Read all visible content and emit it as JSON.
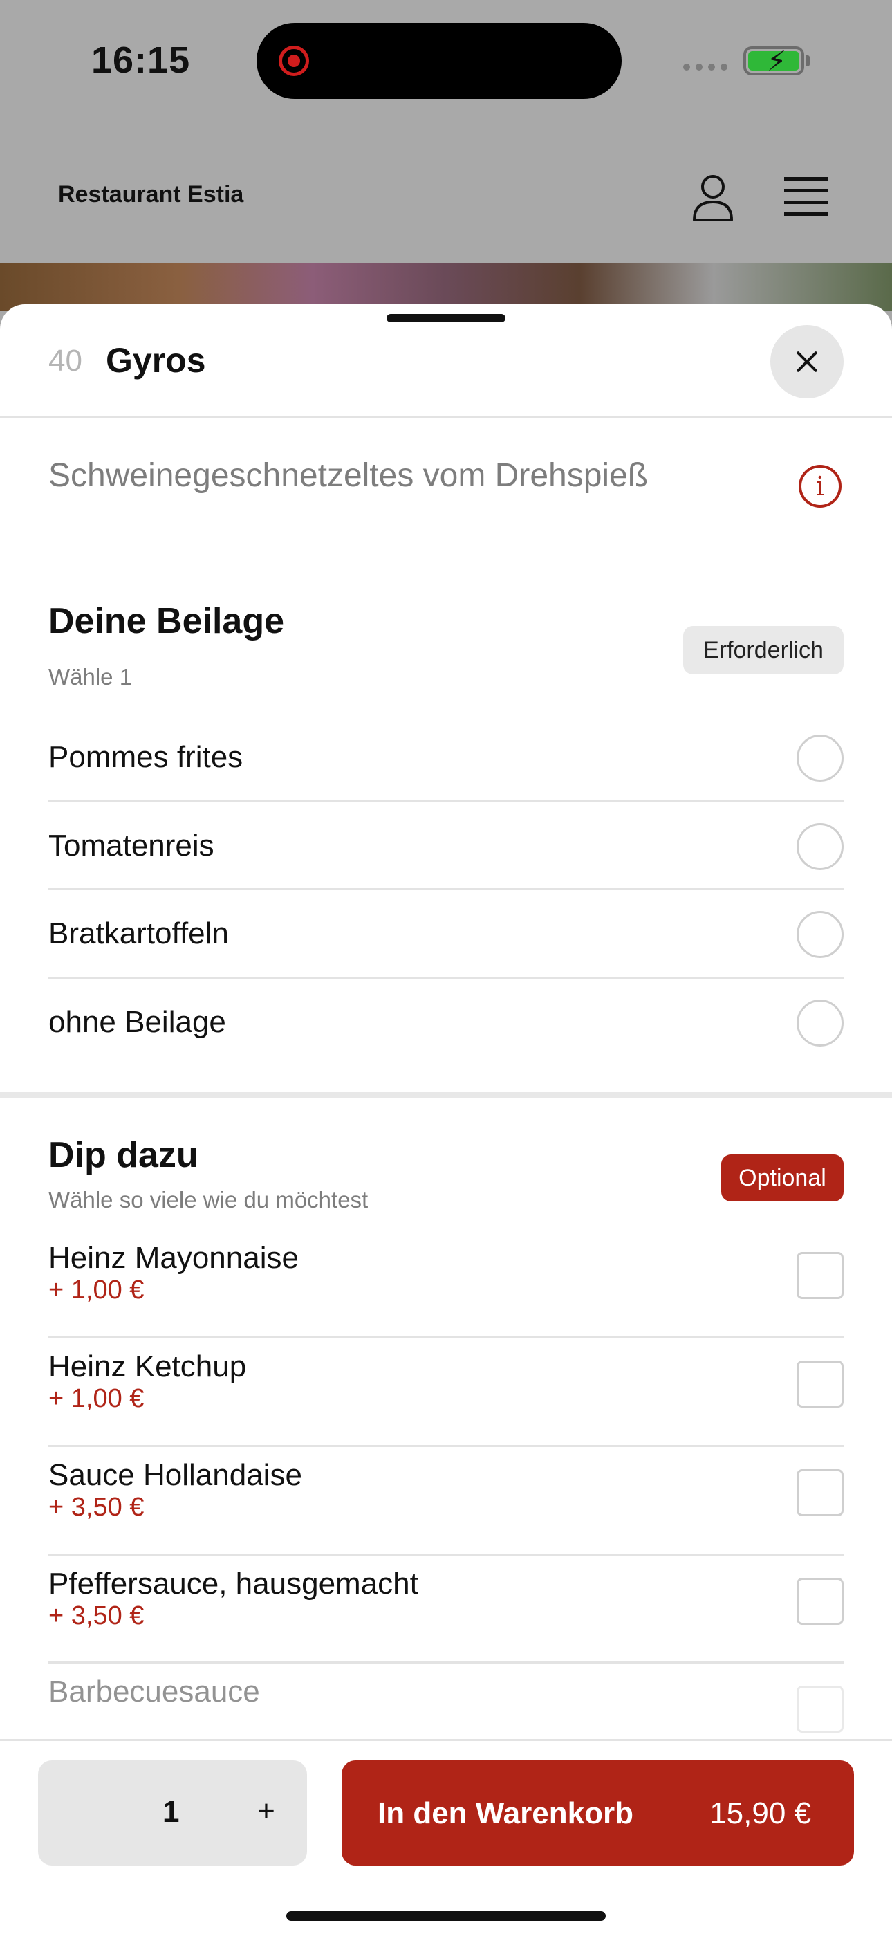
{
  "status_bar": {
    "time": "16:15"
  },
  "header": {
    "restaurant_name": "Restaurant Estia"
  },
  "item": {
    "number": "40",
    "title": "Gyros",
    "description": "Schweinegeschnetzeltes vom Drehspieß"
  },
  "sides": {
    "title": "Deine Beilage",
    "subtitle": "Wähle 1",
    "badge": "Erforderlich",
    "options": [
      {
        "label": "Pommes frites"
      },
      {
        "label": "Tomatenreis"
      },
      {
        "label": "Bratkartoffeln"
      },
      {
        "label": "ohne Beilage"
      }
    ]
  },
  "dips": {
    "title": "Dip dazu",
    "subtitle": "Wähle so viele wie du möchtest",
    "badge": "Optional",
    "options": [
      {
        "label": "Heinz Mayonnaise",
        "price": "+ 1,00 €"
      },
      {
        "label": "Heinz Ketchup",
        "price": "+ 1,00 €"
      },
      {
        "label": "Sauce Hollandaise",
        "price": "+ 3,50 €"
      },
      {
        "label": "Pfeffersauce, hausgemacht",
        "price": "+ 3,50 €"
      },
      {
        "label": "Barbecuesauce",
        "price": ""
      }
    ]
  },
  "footer": {
    "quantity": "1",
    "plus": "+",
    "cart_label": "In den Warenkorb",
    "cart_price": "15,90 €"
  },
  "colors": {
    "accent": "#b02417",
    "muted": "#7d7d7d"
  }
}
